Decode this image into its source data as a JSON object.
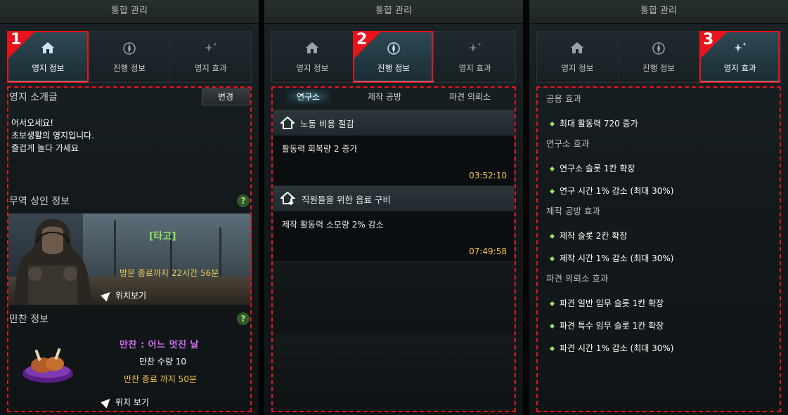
{
  "window_title": "통합 관리",
  "main_tabs": [
    {
      "label": "영지 정보",
      "icon": "house-icon"
    },
    {
      "label": "진행 정보",
      "icon": "compass-icon"
    },
    {
      "label": "영지 효과",
      "icon": "sparkle-icon"
    }
  ],
  "markers": [
    "1",
    "2",
    "3"
  ],
  "territory_info": {
    "intro_title": "영지 소개글",
    "change_button": "변경",
    "intro_lines": [
      "어서오세요!",
      "초보생활의 영지입니다.",
      "즐겁게 놀다 가세요"
    ],
    "trader_title": "무역 상인 정보",
    "help": "?",
    "trader_name": "[타고]",
    "trader_time": "방문 종료까지 22시간 56분",
    "trader_location": "위치보기",
    "feast_title": "만찬 정보",
    "feast_name": "만찬 : 어느 멋진 날",
    "feast_qty": "만찬 수량 10",
    "feast_end": "만찬 종료 까지 50분",
    "feast_location": "위치 보기"
  },
  "progress_info": {
    "subtabs": [
      "연구소",
      "제작 공방",
      "파견 의뢰소"
    ],
    "cards": [
      {
        "title": "노동 비용 절감",
        "desc": "활동력 회복량 2 증가",
        "time": "03:52:10"
      },
      {
        "title": "직원들을 위한 음료 구비",
        "desc": "제작 활동력 소모량 2% 감소",
        "time": "07:49:58"
      }
    ]
  },
  "territory_effects": {
    "groups": [
      {
        "category": "공용 효과",
        "items": [
          "최대 활동력 720 증가"
        ]
      },
      {
        "category": "연구소 효과",
        "items": [
          "연구소 슬롯 1칸 확장",
          "연구 시간 1% 감소 (최대 30%)"
        ]
      },
      {
        "category": "제작 공방 효과",
        "items": [
          "제작 슬롯 2칸 확장",
          "제작 시간 1% 감소 (최대  30%)"
        ]
      },
      {
        "category": "파견 의뢰소 효과",
        "items": [
          "파견 일반 임무 슬롯 1칸 확장",
          "파견 특수 임무 슬롯 1칸 확장",
          "파견 시간 1% 감소 (최대 30%)"
        ]
      }
    ]
  },
  "colors": {
    "highlight": "#e8131b",
    "gold": "#f5c54a",
    "green": "#8ee060",
    "purple": "#d16bf0"
  }
}
